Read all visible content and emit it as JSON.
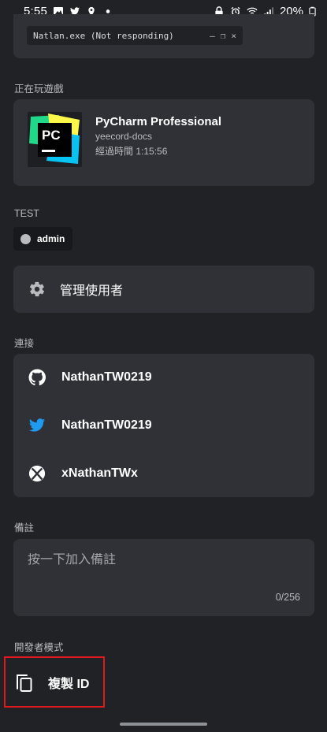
{
  "status_bar": {
    "time": "5:55",
    "left_icons": [
      "image-icon",
      "twitter-icon",
      "location-icon",
      "dot-icon"
    ],
    "right_icons": [
      "lock-icon",
      "alarm-icon",
      "wifi-icon",
      "signal-icon"
    ],
    "battery": "20%"
  },
  "top_card": {
    "window_title": "Natlan.exe (Not responding)",
    "controls": [
      "–",
      "❐",
      "×"
    ]
  },
  "playing": {
    "section_label": "正在玩遊戲",
    "app_name": "PyCharm Professional",
    "icon_text": "PC",
    "detail": "yeecord-docs",
    "elapsed": "經過時間 1:15:56"
  },
  "roles": {
    "section_label": "TEST",
    "items": [
      {
        "label": "admin",
        "color": "#b9bbbe"
      }
    ]
  },
  "manage": {
    "label": "管理使用者",
    "icon": "gear-icon"
  },
  "connections": {
    "section_label": "連接",
    "items": [
      {
        "service": "github",
        "icon": "github-icon",
        "name": "NathanTW0219"
      },
      {
        "service": "twitter",
        "icon": "twitter-icon",
        "name": "NathanTW0219"
      },
      {
        "service": "xbox",
        "icon": "xbox-icon",
        "name": "xNathanTWx"
      }
    ]
  },
  "note": {
    "section_label": "備註",
    "placeholder": "按一下加入備註",
    "value": "",
    "counter": "0/256"
  },
  "developer": {
    "section_label": "開發者模式",
    "copy_label": "複製 ID",
    "icon": "copy-icon"
  },
  "colors": {
    "background": "#202225",
    "card": "#2f3136",
    "twitter_blue": "#1d9bf0",
    "highlight_red": "#e0191f"
  }
}
